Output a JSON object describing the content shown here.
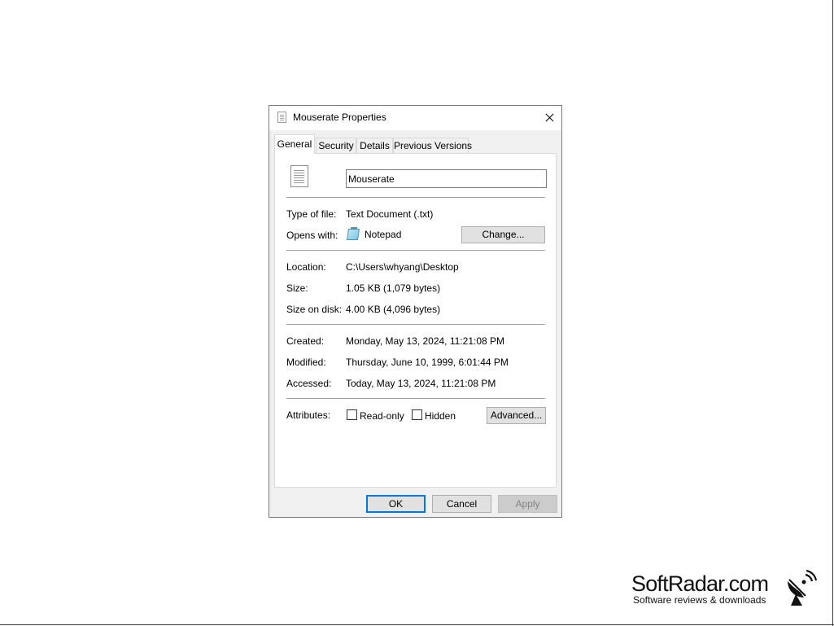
{
  "dialog": {
    "title": "Mouserate Properties",
    "tabs": [
      {
        "label": "General",
        "active": true
      },
      {
        "label": "Security",
        "active": false
      },
      {
        "label": "Details",
        "active": false
      },
      {
        "label": "Previous Versions",
        "active": false
      }
    ],
    "file_name": "Mouserate",
    "type_of_file": {
      "label": "Type of file:",
      "value": "Text Document (.txt)"
    },
    "opens_with": {
      "label": "Opens with:",
      "value": "Notepad",
      "icon": "notepad-icon",
      "button": "Change..."
    },
    "location": {
      "label": "Location:",
      "value": "C:\\Users\\whyang\\Desktop"
    },
    "size": {
      "label": "Size:",
      "value": "1.05 KB (1,079 bytes)"
    },
    "size_on_disk": {
      "label": "Size on disk:",
      "value": "4.00 KB (4,096 bytes)"
    },
    "created": {
      "label": "Created:",
      "value": "Monday, May 13, 2024, 11:21:08 PM"
    },
    "modified": {
      "label": "Modified:",
      "value": "Thursday, June 10, 1999, 6:01:44 PM"
    },
    "accessed": {
      "label": "Accessed:",
      "value": "Today, May 13, 2024, 11:21:08 PM"
    },
    "attributes": {
      "label": "Attributes:",
      "read_only": {
        "label": "Read-only",
        "checked": false
      },
      "hidden": {
        "label": "Hidden",
        "checked": false
      },
      "advanced_button": "Advanced..."
    },
    "buttons": {
      "ok": "OK",
      "cancel": "Cancel",
      "apply": "Apply"
    },
    "accent_color": "#0078d7"
  },
  "watermark": {
    "name": "SoftRadar.com",
    "tagline": "Software reviews & downloads"
  }
}
